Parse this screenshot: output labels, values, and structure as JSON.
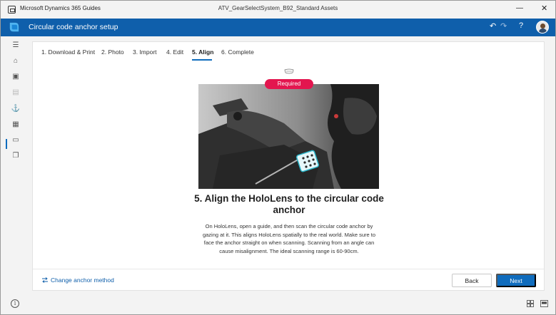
{
  "window": {
    "app_name": "Microsoft Dynamics 365 Guides",
    "document_name": "ATV_GearSelectSystem_B92_Standard Assets",
    "minimize_glyph": "—",
    "close_glyph": "✕"
  },
  "header": {
    "title": "Circular code anchor setup",
    "undo_glyph": "↶",
    "redo_glyph": "↷",
    "help_glyph": "?",
    "brand_color": "#0f5fab"
  },
  "rail": {
    "items": [
      {
        "icon": "hamburger-menu-icon",
        "glyph": "☰"
      },
      {
        "icon": "home-icon",
        "glyph": "⌂"
      },
      {
        "icon": "image-icon",
        "glyph": "▣"
      },
      {
        "icon": "text-block-icon",
        "glyph": "▤"
      },
      {
        "icon": "anchor-icon",
        "glyph": "⚓"
      },
      {
        "icon": "grid-icon",
        "glyph": "▦"
      },
      {
        "icon": "layout-icon",
        "glyph": "▭"
      },
      {
        "icon": "layers-icon",
        "glyph": "❐"
      }
    ],
    "active_index": 4
  },
  "tabs": [
    {
      "label": "1. Download & Print"
    },
    {
      "label": "2. Photo"
    },
    {
      "label": "3. Import"
    },
    {
      "label": "4. Edit"
    },
    {
      "label": "5. Align",
      "active": true
    },
    {
      "label": "6. Complete"
    }
  ],
  "content": {
    "badge": "Required",
    "badge_color": "#e3164f",
    "step_title": "5. Align the HoloLens to the circular code anchor",
    "step_body": "On HoloLens, open a guide, and then scan the circular code anchor by gazing at it. This aligns HoloLens spatially to the real world. Make sure to face the anchor straight on when scanning. Scanning from an angle can cause misalignment. The ideal scanning range is 60-90cm."
  },
  "footer": {
    "change_link": "Change anchor method",
    "back_label": "Back",
    "next_label": "Next",
    "accent_color": "#0f6cbd"
  },
  "statusbar": {
    "info_glyph": "i"
  }
}
